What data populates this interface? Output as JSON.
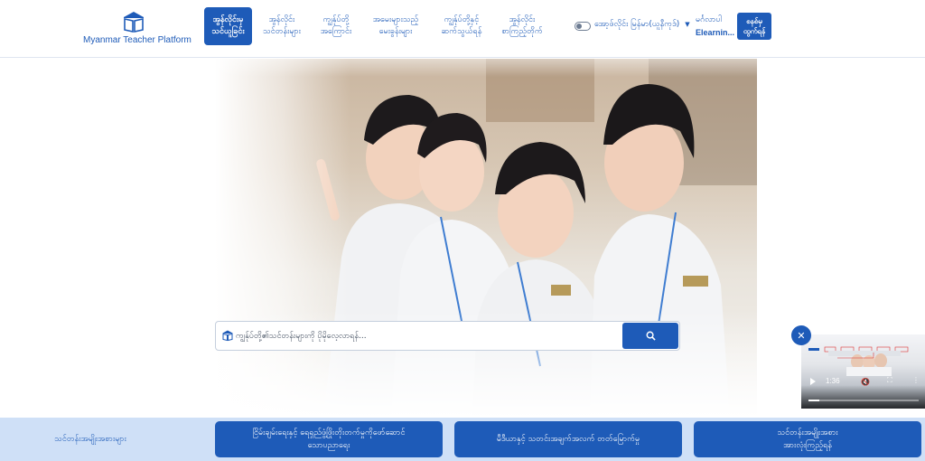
{
  "brand": {
    "logo_icon": "book-icon",
    "name": "Myanmar Teacher Platform",
    "color": "#1e5bb8"
  },
  "nav": {
    "items": [
      {
        "label": "အွန်လိုင်းမှ\nသင်ယူခြင်း",
        "active": true
      },
      {
        "label": "အွန်လိုင်း\nသင်တန်းများ"
      },
      {
        "label": "ကျွန်ုပ်တို့\nအကြောင်း"
      },
      {
        "label": "အမေးများသည့်\nမေးခွန်းများ"
      },
      {
        "label": "ကျွန်ုပ်တို့နှင့်\nဆက်သွယ်ရန်"
      },
      {
        "label": "အွန်လိုင်း\nစာကြည့်တိုက်"
      }
    ]
  },
  "header_right": {
    "toggle_label": "အော့ဖ်လိုင်း",
    "language": "မြန်မာ(ယူနီကုဒ်)",
    "greeting": "မင်္ဂလာပါ",
    "username": "Elearnin...",
    "login_label": "စနစ်မှ\nထွက်ရန်"
  },
  "search": {
    "placeholder": "ကျွန်ုပ်တို့၏သင်တန်းများကို ပိုမိုလေ့လာရန်...",
    "value": "",
    "button_icon": "search-icon"
  },
  "video": {
    "time": "1:36",
    "progress": 0.1
  },
  "footer": {
    "label": "သင်တန်းအမျိုးအစားများ",
    "buttons": [
      "ငြိမ်းချမ်းရေးနှင့် ရေရှည်ဖွံ့ဖြိုးတိုးတက်မှုကိုဖော်ဆောင်\nသောပညာရေး",
      "မီဒီယာနှင့် သတင်းအချက်အလက် တတ်မြောက်မှု",
      "သင်တန်းအမျိုးအစား\nအားလုံးကြည့်ရန်"
    ]
  }
}
